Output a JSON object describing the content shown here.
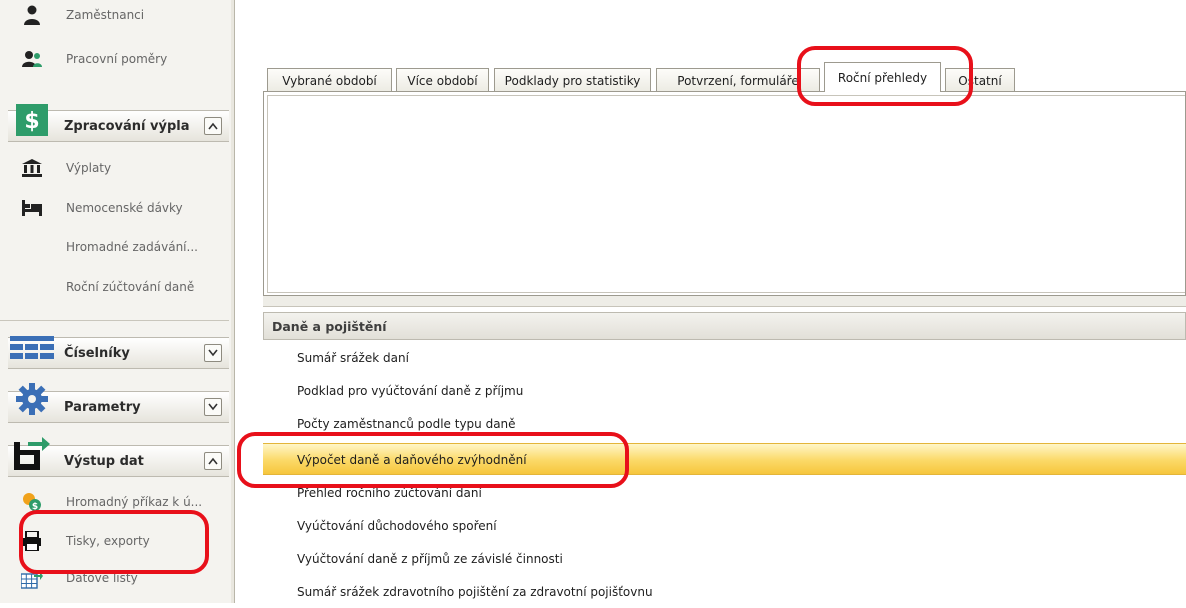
{
  "sidebar": {
    "items_top": [
      {
        "label": "Zaměstnanci",
        "icon": "person-icon"
      },
      {
        "label": "Pracovní poměry",
        "icon": "people-icon"
      }
    ],
    "group_payroll": {
      "label": "Zpracování výpla",
      "icon": "dollar-icon",
      "toggle": "collapse"
    },
    "payroll_items": [
      {
        "label": "Výplaty",
        "icon": "bank-icon"
      },
      {
        "label": "Nemocenské dávky",
        "icon": "bed-icon"
      },
      {
        "label": "Hromadné zadávání..."
      },
      {
        "label": "Roční zúčtování daně"
      }
    ],
    "group_codebooks": {
      "label": "Číselníky",
      "icon": "table-icon",
      "toggle": "expand"
    },
    "group_params": {
      "label": "Parametry",
      "icon": "gear-icon",
      "toggle": "expand"
    },
    "group_output": {
      "label": "Výstup dat",
      "icon": "export-icon",
      "toggle": "collapse"
    },
    "output_items": [
      {
        "label": "Hromadný příkaz k ú...",
        "icon": "coins-icon"
      },
      {
        "label": "Tisky, exporty",
        "icon": "printer-icon"
      },
      {
        "label": "Datové listy",
        "icon": "grid-export-icon"
      }
    ]
  },
  "tabs": [
    {
      "label": "Vybrané období"
    },
    {
      "label": "Více období"
    },
    {
      "label": "Podklady pro statistiky"
    },
    {
      "label": "Potvrzení, formuláře"
    },
    {
      "label": "Roční přehledy"
    },
    {
      "label": "Ostatní"
    }
  ],
  "active_tab": "Roční přehledy",
  "section": {
    "title": "Daně a pojištění"
  },
  "reports": [
    {
      "label": "Sumář srážek daní"
    },
    {
      "label": "Podklad pro vyúčtování daně z příjmu"
    },
    {
      "label": "Počty zaměstnanců podle typu daně"
    },
    {
      "label": "Výpočet daně a daňového zvýhodnění"
    },
    {
      "label": "Přehled ročního zúčtování daní"
    },
    {
      "label": "Vyúčtování důchodového spoření"
    },
    {
      "label": "Vyúčtování daně z příjmů ze závislé činnosti"
    },
    {
      "label": "Sumář srážek zdravotního pojištění za zdravotní pojišťovnu"
    }
  ],
  "selected_report": "Výpočet daně a daňového zvýhodnění",
  "colors": {
    "highlight": "#fbd967",
    "annotation": "#e8101a",
    "payroll_icon": "#2e9c6a"
  }
}
